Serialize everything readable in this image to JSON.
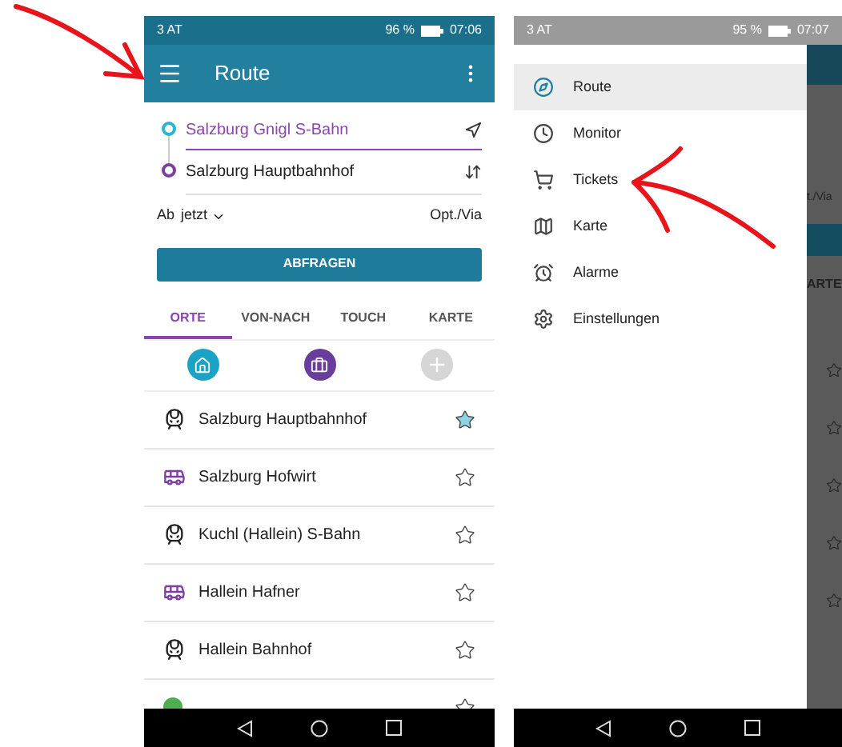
{
  "route_screen": {
    "status_bar": {
      "carrier": "3 AT",
      "battery": "96 %",
      "time": "07:06"
    },
    "title": "Route",
    "from": {
      "value": "Salzburg Gnigl S-Bahn"
    },
    "to": {
      "value": "Salzburg Hauptbahnhof"
    },
    "departure": {
      "label": "Ab",
      "value": "jetzt"
    },
    "options_link": "Opt./Via",
    "query_button": "ABFRAGEN",
    "tabs": [
      {
        "label": "ORTE",
        "selected": true
      },
      {
        "label": "VON-NACH",
        "selected": false
      },
      {
        "label": "TOUCH",
        "selected": false
      },
      {
        "label": "KARTE",
        "selected": false
      }
    ],
    "shortcuts": [
      {
        "kind": "home"
      },
      {
        "kind": "work"
      },
      {
        "kind": "add"
      }
    ],
    "places": [
      {
        "name": "Salzburg Hauptbahnhof",
        "kind": "train",
        "favorite": true
      },
      {
        "name": "Salzburg Hofwirt",
        "kind": "bus",
        "favorite": false
      },
      {
        "name": "Kuchl (Hallein) S-Bahn",
        "kind": "train",
        "favorite": false
      },
      {
        "name": "Hallein Hafner",
        "kind": "bus",
        "favorite": false
      },
      {
        "name": "Hallein Bahnhof",
        "kind": "train",
        "favorite": false
      },
      {
        "kind": "poi",
        "favorite": false
      }
    ]
  },
  "menu_screen": {
    "status_bar": {
      "carrier": "3 AT",
      "battery": "95 %",
      "time": "07:07"
    },
    "menu": [
      {
        "label": "Route",
        "kind": "route",
        "selected": true
      },
      {
        "label": "Monitor",
        "kind": "monitor",
        "selected": false
      },
      {
        "label": "Tickets",
        "kind": "tickets",
        "selected": false
      },
      {
        "label": "Karte",
        "kind": "map",
        "selected": false
      },
      {
        "label": "Alarme",
        "kind": "alarm",
        "selected": false
      },
      {
        "label": "Einstellungen",
        "kind": "settings",
        "selected": false
      }
    ],
    "background": {
      "options_link": "t./Via",
      "tab": "ARTE"
    }
  }
}
